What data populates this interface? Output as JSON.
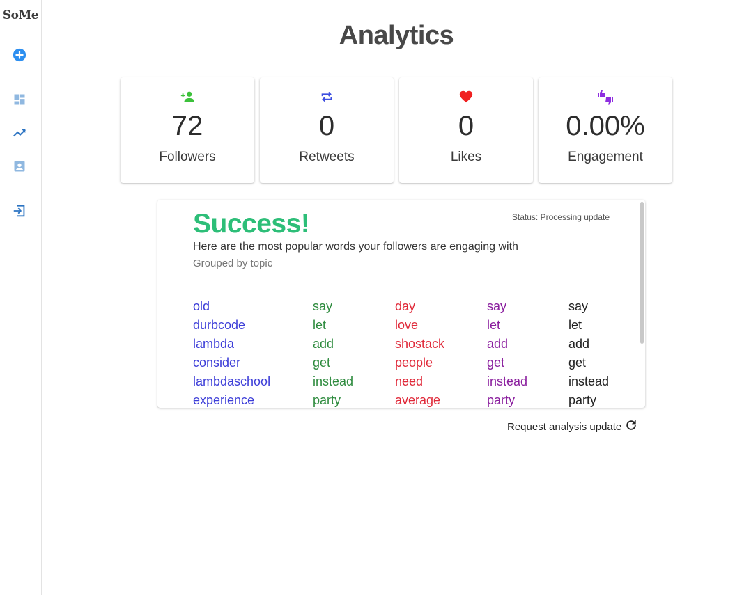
{
  "app": {
    "logo": "SoMe"
  },
  "sidebar": {
    "items": [
      {
        "name": "add",
        "icon": "add-circle-icon"
      },
      {
        "name": "dashboard",
        "icon": "dashboard-icon"
      },
      {
        "name": "analytics",
        "icon": "trending-up-icon"
      },
      {
        "name": "profile",
        "icon": "account-box-icon"
      },
      {
        "name": "logout",
        "icon": "sign-in-icon"
      }
    ]
  },
  "page": {
    "title": "Analytics"
  },
  "stats": [
    {
      "label": "Followers",
      "value": "72",
      "icon": "person-add-icon",
      "color": "#3cc13b"
    },
    {
      "label": "Retweets",
      "value": "0",
      "icon": "repeat-icon",
      "color": "#3d4fe0"
    },
    {
      "label": "Likes",
      "value": "0",
      "icon": "heart-icon",
      "color": "#f02020"
    },
    {
      "label": "Engagement",
      "value": "0.00%",
      "icon": "thumbs-up-down-icon",
      "color": "#8e2de0"
    }
  ],
  "words_panel": {
    "title": "Success!",
    "status": "Status: Processing update",
    "subtitle": "Here are the most popular words your followers are engaging with",
    "grouping": "Grouped by topic",
    "topics": [
      {
        "color": "#3d3ed8",
        "words": [
          "old",
          "durbcode",
          "lambda",
          "consider",
          "lambdaschool",
          "experience"
        ]
      },
      {
        "color": "#2e8b3e",
        "words": [
          "say",
          "let",
          "add",
          "get",
          "instead",
          "party"
        ]
      },
      {
        "color": "#e02a3a",
        "words": [
          "day",
          "love",
          "shostack",
          "people",
          "need",
          "average"
        ]
      },
      {
        "color": "#8a1e9e",
        "words": [
          "say",
          "let",
          "add",
          "get",
          "instead",
          "party"
        ]
      },
      {
        "color": "#222222",
        "words": [
          "say",
          "let",
          "add",
          "get",
          "instead",
          "party"
        ]
      }
    ]
  },
  "actions": {
    "refresh_label": "Request analysis update",
    "refresh_icon": "refresh-icon"
  },
  "colors": {
    "accent": "#2d8ff0",
    "sidebar_icon": "#2b73c2",
    "success": "#2dbe78"
  }
}
